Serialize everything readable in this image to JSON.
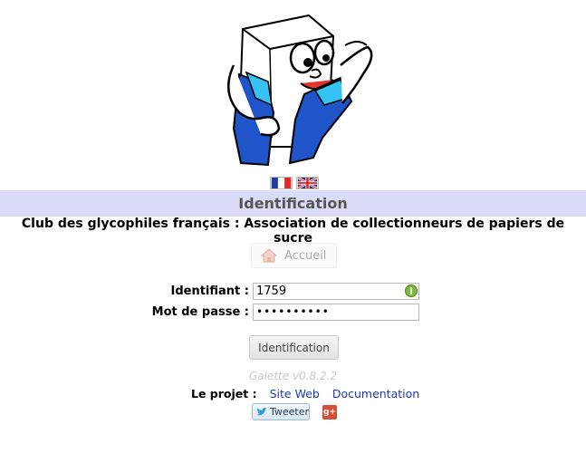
{
  "banner": {
    "title": "Identification"
  },
  "subtitle": "Club des glycophiles français : Association de collectionneurs de papiers de sucre",
  "nav": {
    "home_label": "Accueil"
  },
  "login": {
    "username_label": "Identifiant :",
    "username_value": "1759",
    "password_label": "Mot de passe :",
    "password_mask": "••••••••••",
    "submit_label": "Identification"
  },
  "footer": {
    "version": "Galette v0.8.2.2",
    "project_label": "Le projet :",
    "links": [
      "Site Web",
      "Documentation"
    ],
    "tweet_label": "Tweeter",
    "gplus_label": "g+"
  },
  "colors": {
    "banner_bg": "#dadcf7",
    "link": "#1a3bb5"
  },
  "icons": {
    "languages": [
      "flag-fr-icon",
      "flag-uk-icon"
    ],
    "home": "house-icon",
    "password_strength": "shield-icon",
    "tweet": "twitter-bird-icon"
  }
}
